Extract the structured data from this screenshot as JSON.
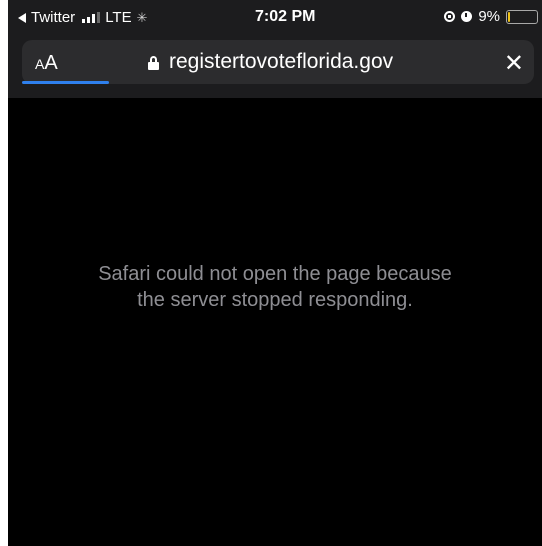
{
  "status_bar": {
    "back_app": "Twitter",
    "network": "LTE",
    "time": "7:02 PM",
    "battery_percent": "9%",
    "battery_level": 0.09,
    "icons": [
      "back-arrow-icon",
      "signal-icon",
      "activity-spinner-icon",
      "rotation-lock-icon",
      "alarm-icon",
      "battery-icon"
    ]
  },
  "url_bar": {
    "reader_label": "AA",
    "domain": "registertovoteflorida.gov",
    "load_progress": 0.17,
    "colors": {
      "progress": "#2f80ed",
      "bar": "#2c2c2e"
    }
  },
  "page": {
    "error_line1": "Safari could not open the page because",
    "error_line2": "the server stopped responding."
  }
}
